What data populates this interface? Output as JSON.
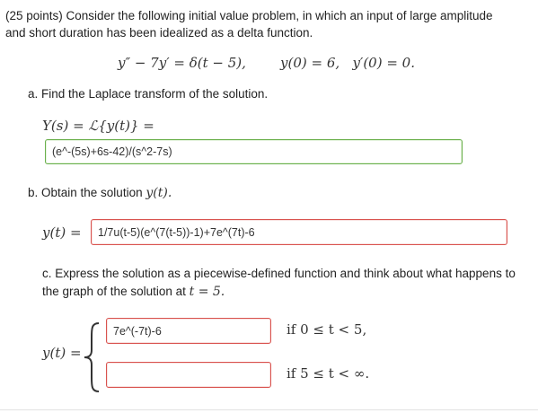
{
  "intro": {
    "line1": "(25 points) Consider the following initial value problem, in which an input of large amplitude",
    "line2": "and short duration has been idealized as a delta function."
  },
  "equation": {
    "ode": "y″ − 7y′ = δ(t − 5),",
    "ic": "y(0) = 6,   y′(0) = 0."
  },
  "part_a": {
    "prompt": "a. Find the Laplace transform of the solution.",
    "label": "Y(s) = ℒ{y(t)} =",
    "answer": "(e^-(5s)+6s-42)/(s^2-7s)"
  },
  "part_b": {
    "prompt": "b. Obtain the solution",
    "prompt_math": "y(t).",
    "label": "y(t) =",
    "answer": "1/7u(t-5)(e^(7(t-5))-1)+7e^(7t)-6"
  },
  "part_c": {
    "prompt_line1": "c. Express the solution as a piecewise-defined function and think about what happens to",
    "prompt_line2": "the graph of the solution at",
    "prompt_math": "t = 5.",
    "label": "y(t) =",
    "piece1_answer": "7e^(-7t)-6",
    "piece1_condition": "if 0 ≤ t < 5,",
    "piece2_answer": "",
    "piece2_condition": "if 5 ≤ t < ∞."
  },
  "colors": {
    "correct_border": "#6ab04c",
    "incorrect_border": "#d9534f"
  }
}
